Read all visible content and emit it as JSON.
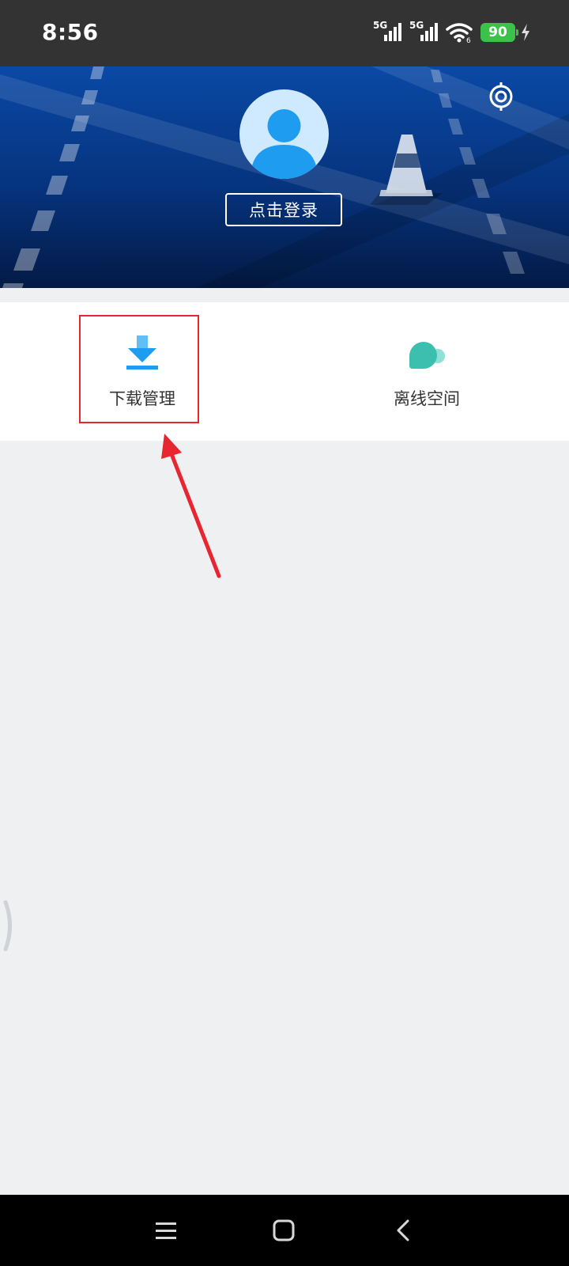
{
  "status_bar": {
    "time": "8:56",
    "signal_1_label": "5G",
    "signal_2_label": "5G",
    "battery_level": "90",
    "icons": [
      "signal-icon",
      "signal-icon",
      "wifi-icon",
      "battery-icon",
      "charging-icon"
    ]
  },
  "header": {
    "login_label": "点击登录",
    "icons": [
      "settings-icon",
      "avatar-icon"
    ]
  },
  "menu": {
    "items": [
      {
        "label": "下载管理",
        "icon": "download-icon",
        "color": "#1e9cf0",
        "highlighted": true
      },
      {
        "label": "离线空间",
        "icon": "cloud-icon",
        "color": "#3dbfb0",
        "highlighted": false
      }
    ]
  },
  "annotation": {
    "color": "#e8262f"
  },
  "nav_bar": {
    "icons": [
      "menu-icon",
      "home-icon",
      "back-icon"
    ]
  }
}
